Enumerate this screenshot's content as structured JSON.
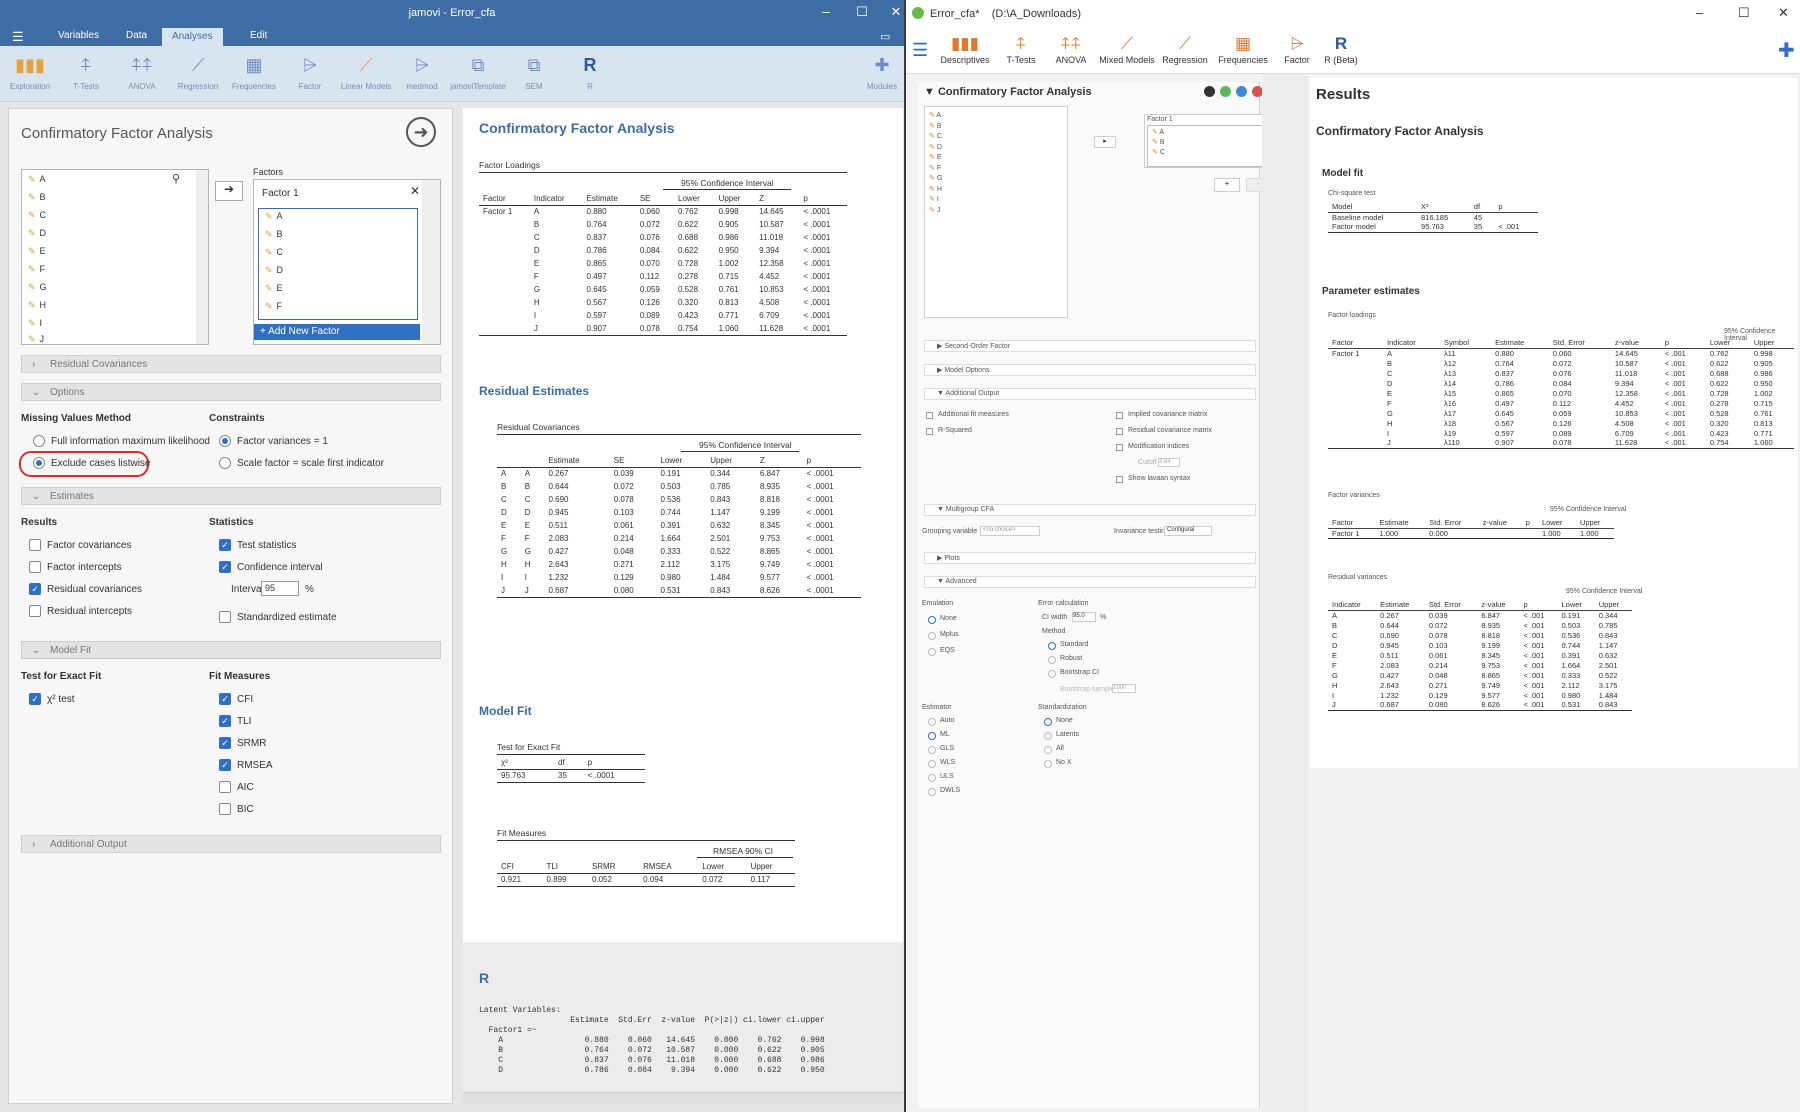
{
  "left": {
    "title": "jamovi - Error_cfa",
    "menu": [
      "Variables",
      "Data",
      "Analyses",
      "Edit"
    ],
    "ribbon": [
      "Exploration",
      "T-Tests",
      "ANOVA",
      "Regression",
      "Frequencies",
      "Factor",
      "Linear Models",
      "medmod",
      "jamoviTemplate",
      "SEM",
      "R",
      "Modules"
    ],
    "panel_title": "Confirmatory Factor Analysis",
    "factors_label": "Factors",
    "variables": [
      "A",
      "B",
      "C",
      "D",
      "E",
      "F",
      "G",
      "H",
      "I",
      "J"
    ],
    "factor_name": "Factor 1",
    "factor_items": [
      "A",
      "B",
      "C",
      "D",
      "E",
      "F"
    ],
    "add_factor": "+ Add New Factor",
    "sections": {
      "residual_cov": "Residual Covariances",
      "options": "Options",
      "estimates": "Estimates",
      "model_fit": "Model Fit",
      "additional": "Additional Output"
    },
    "missing_label": "Missing Values Method",
    "missing_opts": [
      "Full information maximum likelihood",
      "Exclude cases listwise"
    ],
    "constraints_label": "Constraints",
    "constraint_opts": [
      "Factor variances = 1",
      "Scale factor = scale first indicator"
    ],
    "results_label": "Results",
    "results_opts": [
      "Factor covariances",
      "Factor intercepts",
      "Residual covariances",
      "Residual intercepts"
    ],
    "statistics_label": "Statistics",
    "stats_opts": [
      "Test statistics",
      "Confidence interval",
      "Standardized estimate"
    ],
    "interval_label": "Interval",
    "interval_value": "95",
    "interval_unit": "%",
    "exact_label": "Test for Exact Fit",
    "exact_opt": "χ² test",
    "fit_label": "Fit Measures",
    "fit_opts": [
      "CFI",
      "TLI",
      "SRMR",
      "RMSEA",
      "AIC",
      "BIC"
    ]
  },
  "results": {
    "heading": "Confirmatory Factor Analysis",
    "loadings_title": "Factor Loadings",
    "ci_label": "95% Confidence Interval",
    "load_headers": [
      "Factor",
      "Indicator",
      "Estimate",
      "SE",
      "Lower",
      "Upper",
      "Z",
      "p"
    ],
    "load_rows": [
      [
        "Factor 1",
        "A",
        "0.880",
        "0.060",
        "0.762",
        "0.998",
        "14.645",
        "< .0001"
      ],
      [
        "",
        "B",
        "0.764",
        "0.072",
        "0.622",
        "0.905",
        "10.587",
        "< .0001"
      ],
      [
        "",
        "C",
        "0.837",
        "0.076",
        "0.688",
        "0.986",
        "11.018",
        "< .0001"
      ],
      [
        "",
        "D",
        "0.786",
        "0.084",
        "0.622",
        "0.950",
        "9.394",
        "< .0001"
      ],
      [
        "",
        "E",
        "0.865",
        "0.070",
        "0.728",
        "1.002",
        "12.358",
        "< .0001"
      ],
      [
        "",
        "F",
        "0.497",
        "0.112",
        "0.278",
        "0.715",
        "4.452",
        "< .0001"
      ],
      [
        "",
        "G",
        "0.645",
        "0.059",
        "0.528",
        "0.761",
        "10.853",
        "< .0001"
      ],
      [
        "",
        "H",
        "0.567",
        "0.126",
        "0.320",
        "0.813",
        "4.508",
        "< .0001"
      ],
      [
        "",
        "I",
        "0.597",
        "0.089",
        "0.423",
        "0.771",
        "6.709",
        "< .0001"
      ],
      [
        "",
        "J",
        "0.907",
        "0.078",
        "0.754",
        "1.060",
        "11.628",
        "< .0001"
      ]
    ],
    "resid_heading": "Residual Estimates",
    "resid_title": "Residual Covariances",
    "resid_headers": [
      "",
      "",
      "Estimate",
      "SE",
      "Lower",
      "Upper",
      "Z",
      "p"
    ],
    "resid_rows": [
      [
        "A",
        "A",
        "0.267",
        "0.039",
        "0.191",
        "0.344",
        "6.847",
        "< .0001"
      ],
      [
        "B",
        "B",
        "0.644",
        "0.072",
        "0.503",
        "0.785",
        "8.935",
        "< .0001"
      ],
      [
        "C",
        "C",
        "0.690",
        "0.078",
        "0.536",
        "0.843",
        "8.818",
        "< .0001"
      ],
      [
        "D",
        "D",
        "0.945",
        "0.103",
        "0.744",
        "1.147",
        "9.199",
        "< .0001"
      ],
      [
        "E",
        "E",
        "0.511",
        "0.061",
        "0.391",
        "0.632",
        "8.345",
        "< .0001"
      ],
      [
        "F",
        "F",
        "2.083",
        "0.214",
        "1.664",
        "2.501",
        "9.753",
        "< .0001"
      ],
      [
        "G",
        "G",
        "0.427",
        "0.048",
        "0.333",
        "0.522",
        "8.865",
        "< .0001"
      ],
      [
        "H",
        "H",
        "2.643",
        "0.271",
        "2.112",
        "3.175",
        "9.749",
        "< .0001"
      ],
      [
        "I",
        "I",
        "1.232",
        "0.129",
        "0.980",
        "1.484",
        "9.577",
        "< .0001"
      ],
      [
        "J",
        "J",
        "0.687",
        "0.080",
        "0.531",
        "0.843",
        "8.626",
        "< .0001"
      ]
    ],
    "fit_heading": "Model Fit",
    "exact_title": "Test for Exact Fit",
    "exact_headers": [
      "χ²",
      "df",
      "p"
    ],
    "exact_row": [
      "95.763",
      "35",
      "< .0001"
    ],
    "fitm_title": "Fit Measures",
    "rmsea_ci": "RMSEA 90% CI",
    "fitm_headers": [
      "CFI",
      "TLI",
      "SRMR",
      "RMSEA",
      "Lower",
      "Upper"
    ],
    "fitm_row": [
      "0.921",
      "0.899",
      "0.052",
      "0.094",
      "0.072",
      "0.117"
    ],
    "r_heading": "R",
    "r_output": "Latent Variables:\n                   Estimate  Std.Err  z-value  P(>|z|) ci.lower ci.upper\n  Factor1 =~\n    A                 0.880    0.060   14.645    0.000    0.762    0.998\n    B                 0.764    0.072   10.587    0.000    0.622    0.905\n    C                 0.837    0.076   11.018    0.000    0.688    0.986\n    D                 0.786    0.084    9.394    0.000    0.622    0.950"
  },
  "right": {
    "title": "Error_cfa*    (D:\\A_Downloads)",
    "ribbon": [
      "Descriptives",
      "T-Tests",
      "ANOVA",
      "Mixed Models",
      "Regression",
      "Frequencies",
      "Factor",
      "R (Beta)"
    ],
    "panel_title": "Confirmatory Factor Analysis",
    "variables": [
      "A",
      "B",
      "C",
      "D",
      "E",
      "F",
      "G",
      "H",
      "I",
      "J"
    ],
    "factor_name": "Factor 1",
    "factor_items": [
      "A",
      "B",
      "C"
    ],
    "sections": [
      "Second-Order Factor",
      "Model Options",
      "Additional Output",
      "Multigroup CFA",
      "Plots",
      "Advanced"
    ],
    "addl_left": [
      "Additional fit measures",
      "R-Squared"
    ],
    "addl_right": [
      "Implied covariance matrix",
      "Residual covariance matrix",
      "Modification indices",
      "Cutoff",
      "Show lavaan syntax"
    ],
    "cutoff_value": "3.84",
    "grouping_label": "Grouping variable",
    "grouping_value": "<no choice>",
    "invariance_label": "Invariance testing",
    "invariance_value": "Configural",
    "emulation_label": "Emulation",
    "emulation_opts": [
      "None",
      "Mplus",
      "EQS"
    ],
    "errcalc_label": "Error calculation",
    "ciwidth_label": "CI width",
    "ciwidth_value": "95.0",
    "method_label": "Method",
    "method_opts": [
      "Standard",
      "Robust",
      "Bootstrap CI"
    ],
    "bootstrap_label": "Bootstrap samples",
    "bootstrap_value": "1000",
    "estimator_label": "Estimator",
    "estimator_opts": [
      "Auto",
      "ML",
      "GLS",
      "WLS",
      "ULS",
      "DWLS"
    ],
    "standard_label": "Standardization",
    "standard_opts": [
      "None",
      "Latents",
      "All",
      "No X"
    ],
    "results_title": "Results",
    "cfa_title": "Confirmatory Factor Analysis",
    "modelfit": "Model fit",
    "chisq_title": "Chi-square test",
    "chisq_headers": [
      "Model",
      "X²",
      "df",
      "p"
    ],
    "chisq_rows": [
      [
        "Baseline model",
        "816.185",
        "45",
        ""
      ],
      [
        "Factor model",
        "95.763",
        "35",
        "< .001"
      ]
    ],
    "param_title": "Parameter estimates",
    "loadings_title": "Factor loadings",
    "ci_label": "95% Confidence Interval",
    "load_headers": [
      "Factor",
      "Indicator",
      "Symbol",
      "Estimate",
      "Std. Error",
      "z-value",
      "p",
      "Lower",
      "Upper"
    ],
    "load_rows": [
      [
        "Factor 1",
        "A",
        "λ11",
        "0.880",
        "0.060",
        "14.645",
        "< .001",
        "0.762",
        "0.998"
      ],
      [
        "",
        "B",
        "λ12",
        "0.764",
        "0.072",
        "10.587",
        "< .001",
        "0.622",
        "0.905"
      ],
      [
        "",
        "C",
        "λ13",
        "0.837",
        "0.076",
        "11.018",
        "< .001",
        "0.688",
        "0.986"
      ],
      [
        "",
        "D",
        "λ14",
        "0.786",
        "0.084",
        "9.394",
        "< .001",
        "0.622",
        "0.950"
      ],
      [
        "",
        "E",
        "λ15",
        "0.865",
        "0.070",
        "12.358",
        "< .001",
        "0.728",
        "1.002"
      ],
      [
        "",
        "F",
        "λ16",
        "0.497",
        "0.112",
        "4.452",
        "< .001",
        "0.278",
        "0.715"
      ],
      [
        "",
        "G",
        "λ17",
        "0.645",
        "0.059",
        "10.853",
        "< .001",
        "0.528",
        "0.761"
      ],
      [
        "",
        "H",
        "λ18",
        "0.567",
        "0.126",
        "4.508",
        "< .001",
        "0.320",
        "0.813"
      ],
      [
        "",
        "I",
        "λ19",
        "0.597",
        "0.089",
        "6.709",
        "< .001",
        "0.423",
        "0.771"
      ],
      [
        "",
        "J",
        "λ110",
        "0.907",
        "0.078",
        "11.628",
        "< .001",
        "0.754",
        "1.060"
      ]
    ],
    "fvar_title": "Factor variances",
    "fvar_headers": [
      "Factor",
      "Estimate",
      "Std. Error",
      "z-value",
      "p",
      "Lower",
      "Upper"
    ],
    "fvar_row": [
      "Factor 1",
      "1.000",
      "0.000",
      "",
      "",
      "1.000",
      "1.000"
    ],
    "rvar_title": "Residual variances",
    "rvar_headers": [
      "Indicator",
      "Estimate",
      "Std. Error",
      "z-value",
      "p",
      "Lower",
      "Upper"
    ],
    "rvar_rows": [
      [
        "A",
        "0.267",
        "0.039",
        "6.847",
        "< .001",
        "0.191",
        "0.344"
      ],
      [
        "B",
        "0.644",
        "0.072",
        "8.935",
        "< .001",
        "0.503",
        "0.785"
      ],
      [
        "C",
        "0.690",
        "0.078",
        "8.818",
        "< .001",
        "0.536",
        "0.843"
      ],
      [
        "D",
        "0.945",
        "0.103",
        "9.199",
        "< .001",
        "0.744",
        "1.147"
      ],
      [
        "E",
        "0.511",
        "0.061",
        "8.345",
        "< .001",
        "0.391",
        "0.632"
      ],
      [
        "F",
        "2.083",
        "0.214",
        "9.753",
        "< .001",
        "1.664",
        "2.501"
      ],
      [
        "G",
        "0.427",
        "0.048",
        "8.865",
        "< .001",
        "0.333",
        "0.522"
      ],
      [
        "H",
        "2.643",
        "0.271",
        "9.749",
        "< .001",
        "2.112",
        "3.175"
      ],
      [
        "I",
        "1.232",
        "0.129",
        "9.577",
        "< .001",
        "0.980",
        "1.484"
      ],
      [
        "J",
        "0.687",
        "0.080",
        "8.626",
        "< .001",
        "0.531",
        "0.843"
      ]
    ]
  },
  "colors": {
    "brand": "#3e6da6",
    "accent": "#2f6fc4",
    "highlight": "#d32f2f"
  }
}
